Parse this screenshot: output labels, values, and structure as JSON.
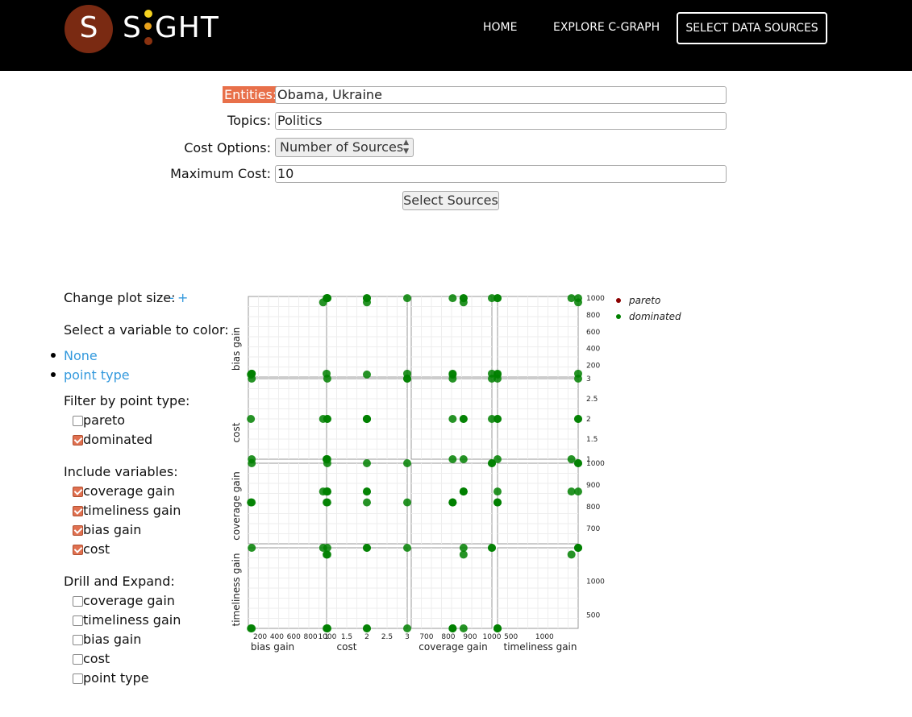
{
  "header": {
    "logo_letter": "S",
    "brand_left": "S",
    "brand_right": "GHT",
    "nav_home": "HOME",
    "nav_explore": "EXPLORE C-GRAPH",
    "nav_select": "SELECT DATA SOURCES"
  },
  "form": {
    "entities_label": "Entities:",
    "entities_value": "Obama, Ukraine",
    "topics_label": "Topics:",
    "topics_value": "Politics",
    "cost_label": "Cost Options:",
    "cost_value": "Number of Sources",
    "max_cost_label": "Maximum Cost:",
    "max_cost_value": "10",
    "submit_label": "Select Sources"
  },
  "side": {
    "plot_size_label": "Change plot size:",
    "plot_size_minus": "-",
    "plot_size_plus": "+",
    "color_label": "Select a variable to color:",
    "color_options": [
      "None",
      "point type"
    ],
    "filter_label": "Filter by point type:",
    "filter_items": [
      {
        "label": "pareto",
        "checked": false
      },
      {
        "label": "dominated",
        "checked": true
      }
    ],
    "include_label": "Include variables:",
    "include_items": [
      {
        "label": "coverage gain",
        "checked": true
      },
      {
        "label": "timeliness gain",
        "checked": true
      },
      {
        "label": "bias gain",
        "checked": true
      },
      {
        "label": "cost",
        "checked": true
      }
    ],
    "drill_label": "Drill and Expand:",
    "drill_items": [
      {
        "label": "coverage gain",
        "checked": false
      },
      {
        "label": "timeliness gain",
        "checked": false
      },
      {
        "label": "bias gain",
        "checked": false
      },
      {
        "label": "cost",
        "checked": false
      },
      {
        "label": "point type",
        "checked": false
      }
    ]
  },
  "chart_data": {
    "type": "scatter",
    "variables": [
      "bias gain",
      "cost",
      "coverage gain",
      "timeliness gain"
    ],
    "legend": [
      {
        "label": "pareto",
        "color": "#8b0000"
      },
      {
        "label": "dominated",
        "color": "#008000"
      }
    ],
    "legend_position": "top-right",
    "grid": true,
    "ticks": {
      "bias gain": [
        "200",
        "400",
        "600",
        "800",
        "1000"
      ],
      "cost": [
        "1",
        "1.5",
        "2",
        "2.5",
        "3"
      ],
      "coverage gain": [
        "700",
        "800",
        "900",
        "1000"
      ],
      "timeliness gain": [
        "500",
        "1000"
      ]
    },
    "ranges": {
      "bias gain": [
        60,
        1020
      ],
      "cost": [
        1,
        3
      ],
      "coverage gain": [
        630,
        1000
      ],
      "timeliness gain": [
        300,
        1500
      ]
    },
    "points_note_excluded": true,
    "points": [
      {
        "bias": 90,
        "cost": 2,
        "coverage": 820,
        "timeliness": 300,
        "type": "dominated"
      },
      {
        "bias": 100,
        "cost": 3,
        "coverage": 1000,
        "timeliness": 1500,
        "type": "dominated"
      },
      {
        "bias": 100,
        "cost": 1,
        "coverage": 820,
        "timeliness": 300,
        "type": "dominated"
      },
      {
        "bias": 950,
        "cost": 2,
        "coverage": 870,
        "timeliness": 1500,
        "type": "dominated"
      },
      {
        "bias": 1000,
        "cost": 1,
        "coverage": 870,
        "timeliness": 1400,
        "type": "dominated"
      },
      {
        "bias": 1000,
        "cost": 3,
        "coverage": 820,
        "timeliness": 300,
        "type": "dominated"
      },
      {
        "bias": 1000,
        "cost": 2,
        "coverage": 1000,
        "timeliness": 1500,
        "type": "dominated"
      },
      {
        "bias": 1000,
        "cost": 2,
        "coverage": 870,
        "timeliness": 300,
        "type": "dominated"
      }
    ]
  }
}
